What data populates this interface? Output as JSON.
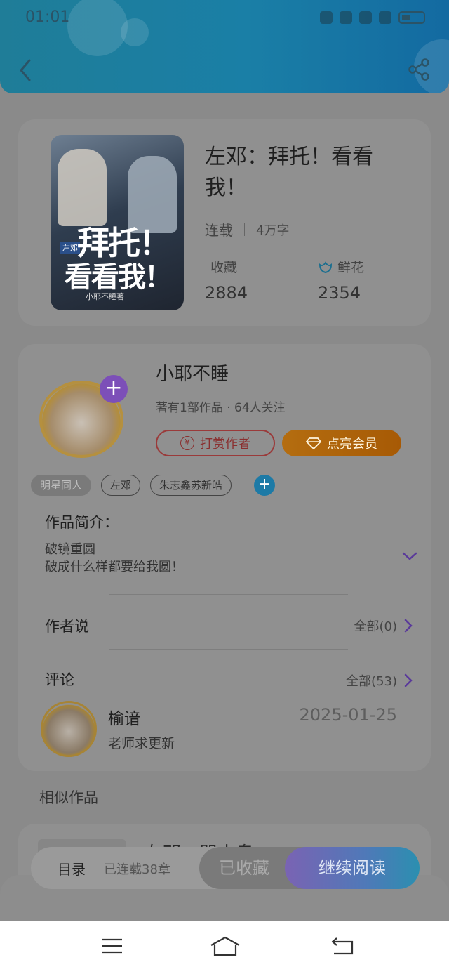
{
  "status_bar": {
    "time": "01:01",
    "battery": "4"
  },
  "book": {
    "title": "左邓：拜托！看看我！",
    "status": "连载",
    "word_count": "4万字",
    "cover": {
      "title_line1": "拜托！",
      "title_line2": "看看我！",
      "tag": "左邓",
      "author": "小耶不睡著"
    },
    "stats": [
      {
        "label": "收藏",
        "value": "2884"
      },
      {
        "label": "鲜花",
        "value": "2354"
      }
    ]
  },
  "author": {
    "name": "小耶不睡",
    "meta": "著有1部作品 · 64人关注",
    "tip_label": "打赏作者",
    "vip_label": "点亮会员"
  },
  "tags": [
    "明星同人",
    "左邓",
    "朱志鑫苏新皓"
  ],
  "intro": {
    "title": "作品简介：",
    "line1": "破镜重圆",
    "line2": "破成什么样都要给我圆！"
  },
  "author_says": {
    "title": "作者说",
    "link": "全部(0)"
  },
  "comments": {
    "title": "评论",
    "link": "全部(53)",
    "items": [
      {
        "user": "榆谙",
        "date": "2025-01-25",
        "text": "老师求更新"
      }
    ]
  },
  "similar": {
    "title": "相似作品",
    "first_title": "左邓：哭小鬼"
  },
  "action_bar": {
    "toc_label": "目录",
    "chapter_count": "已连载38章",
    "favorited_label": "已收藏",
    "read_label": "继续阅读"
  },
  "colors": {
    "header": "#1a7fa6",
    "accent_purple": "#7c4fb8",
    "vip_orange": "#a75a05"
  }
}
